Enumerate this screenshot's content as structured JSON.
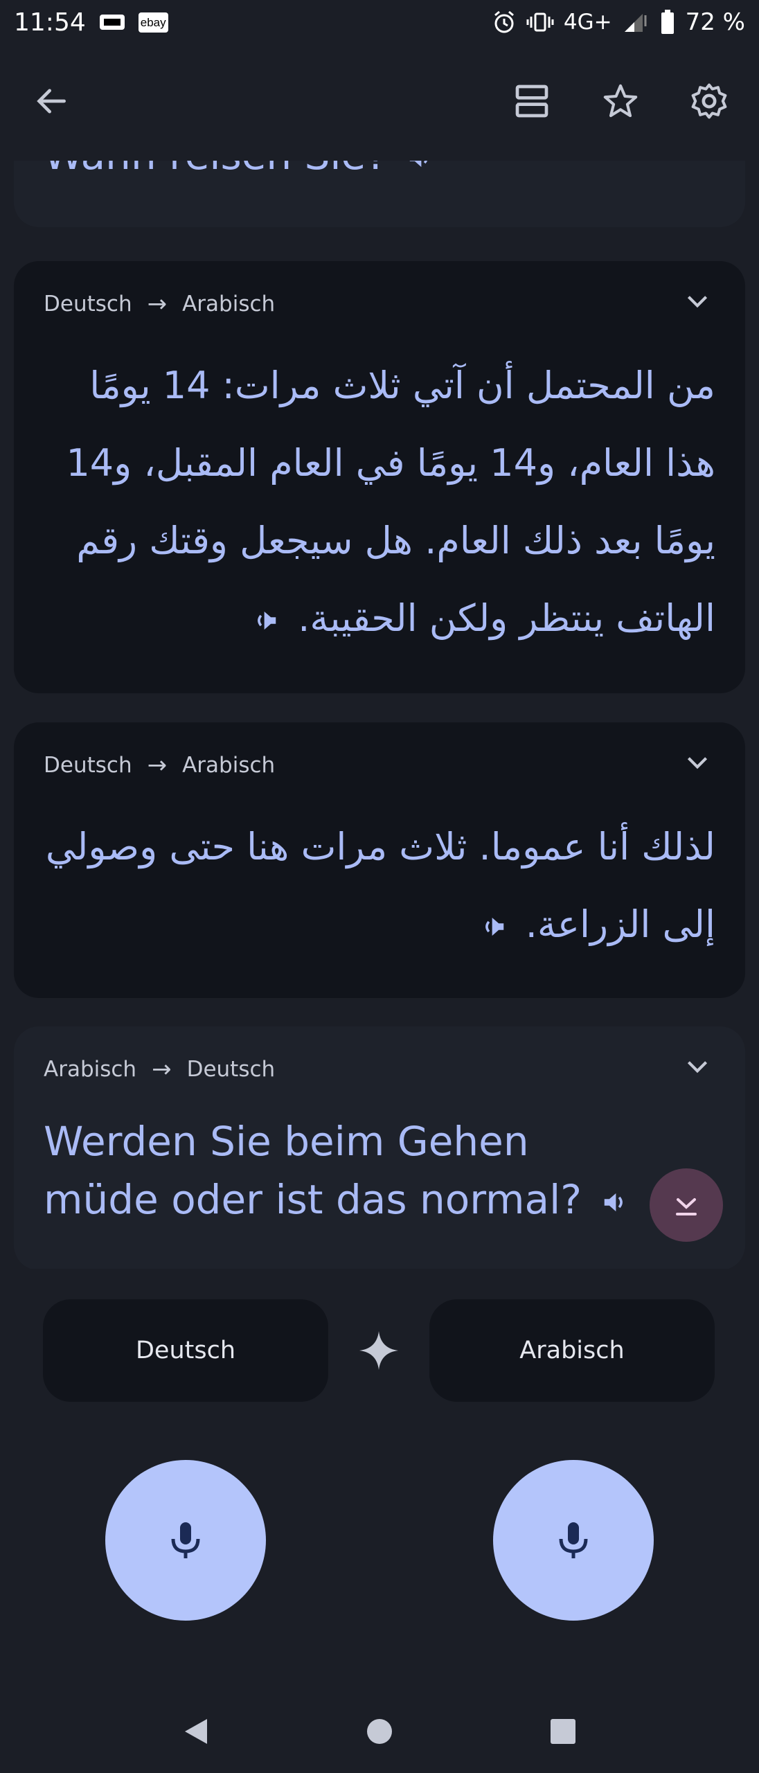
{
  "status": {
    "time": "11:54",
    "ebay": "ebay",
    "network": "4G+",
    "battery": "72 %"
  },
  "top_icons": [
    "back-arrow-icon",
    "layers-icon",
    "star-icon",
    "gear-icon"
  ],
  "cards": [
    {
      "text": "Wann reisen Sie?"
    },
    {
      "source": "Deutsch",
      "target": "Arabisch",
      "text": "من المحتمل أن آتي ثلاث مرات: 14 يومًا هذا العام، و14 يومًا في العام المقبل، و14 يومًا بعد ذلك العام. هل سيجعل وقتك رقم الهاتف ينتظر ولكن الحقيبة."
    },
    {
      "source": "Deutsch",
      "target": "Arabisch",
      "text": "لذلك أنا عموما. ثلاث مرات هنا حتى وصولي إلى الزراعة."
    },
    {
      "source": "Arabisch",
      "target": "Deutsch",
      "text": "Werden Sie beim Gehen müde oder ist das normal?"
    }
  ],
  "languages": {
    "left": "Deutsch",
    "right": "Arabisch"
  },
  "colors": {
    "background": "#1b1e26",
    "card": "#11141b",
    "accent_text": "#aabbf6",
    "mic": "#b4c5fb",
    "fab": "#55394f"
  }
}
